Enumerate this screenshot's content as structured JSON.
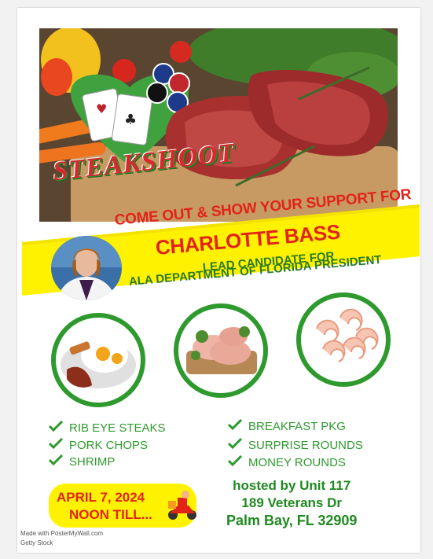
{
  "poster": {
    "title": "STEAKSHOOT",
    "banner": {
      "line1": "COME OUT & SHOW YOUR SUPPORT FOR",
      "line2": "CHARLOTTE BASS",
      "line3": "LEAD CANDIDATE FOR",
      "line4": "ALA DEPARTMENT OF FLORIDA PRESIDENT"
    },
    "prizes_left": [
      "RIB EYE STEAKS",
      "PORK CHOPS",
      "SHRIMP"
    ],
    "prizes_right": [
      "BREAKFAST PKG",
      "SURPRISE ROUNDS",
      "MONEY ROUNDS"
    ],
    "date_line1": "APRIL 7, 2024",
    "date_line2": "NOON TILL...",
    "host_line1": "hosted by Unit 117",
    "host_line2": "189 Veterans Dr",
    "host_line3": "Palm Bay, FL 32909",
    "credit_line1": "Made with PosterMyWall.com",
    "credit_line2": "Getty Stock"
  },
  "colors": {
    "accent_red": "#e2231a",
    "accent_green": "#2e9a2e",
    "banner_yellow": "#fff200"
  },
  "icons": {
    "check": "check-icon",
    "delivery": "delivery-scooter-icon"
  }
}
